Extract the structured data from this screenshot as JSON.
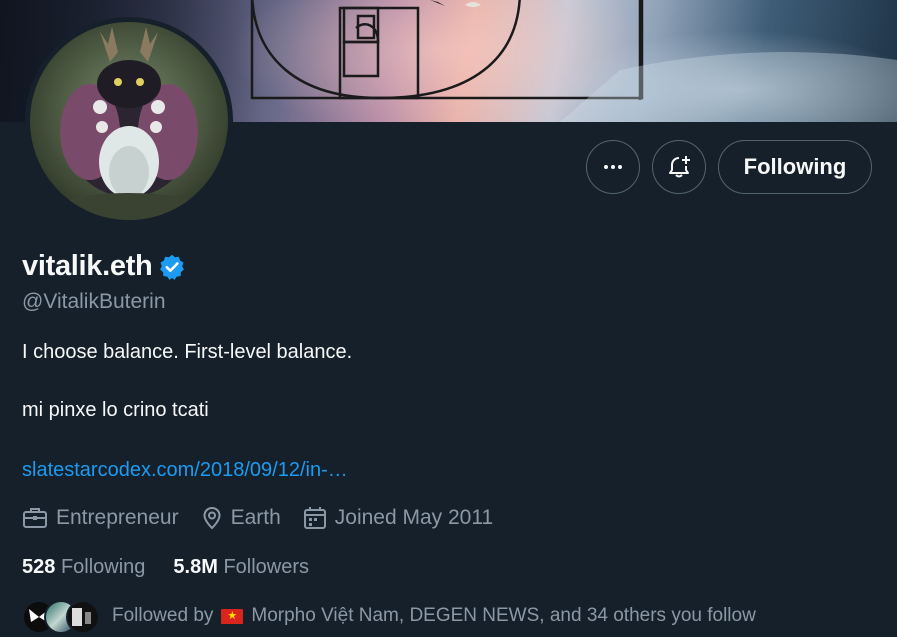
{
  "profile": {
    "display_name": "vitalik.eth",
    "handle": "@VitalikButerin",
    "bio_line1": "I choose balance. First-level balance.",
    "bio_line2": "mi pinxe lo crino tcati",
    "link_text": "slatestarcodex.com/2018/09/12/in-…",
    "occupation": "Entrepreneur",
    "location": "Earth",
    "joined": "Joined May 2011"
  },
  "actions": {
    "more_icon": "more-horizontal-icon",
    "notify_icon": "bell-plus-icon",
    "following_label": "Following"
  },
  "stats": {
    "following_count": "528",
    "following_label": "Following",
    "followers_count": "5.8M",
    "followers_label": "Followers"
  },
  "followed_by": {
    "prefix": "Followed by",
    "names": "Morpho Việt Nam, DEGEN NEWS, and 34 others you follow"
  },
  "colors": {
    "background": "#15202b",
    "accent": "#1d9bf0",
    "muted_text": "#8b98a5",
    "border": "#536471"
  }
}
